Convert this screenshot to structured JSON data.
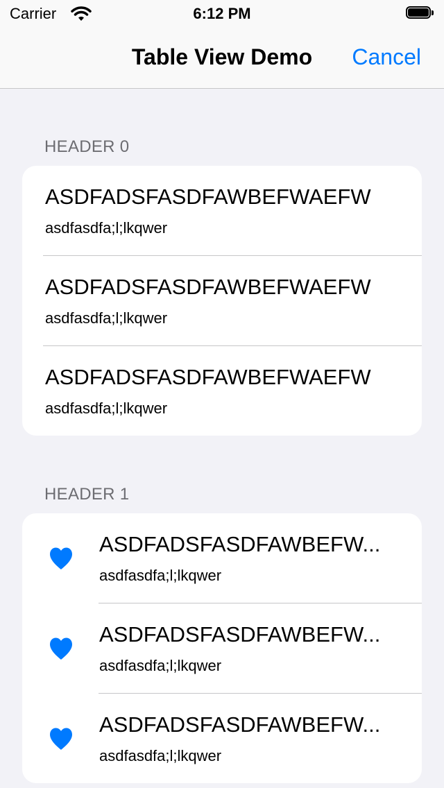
{
  "status_bar": {
    "carrier": "Carrier",
    "time": "6:12 PM",
    "icons": [
      "wifi-icon",
      "battery-icon"
    ]
  },
  "nav_bar": {
    "title": "Table View Demo",
    "cancel_label": "Cancel",
    "accent_color": "#007aff"
  },
  "sections": [
    {
      "header": "HEADER 0",
      "rows": [
        {
          "title": "ASDFADSFASDFAWBEFWAEFW",
          "subtitle": "asdfasdfa;l;lkqwer"
        },
        {
          "title": "ASDFADSFASDFAWBEFWAEFW",
          "subtitle": "asdfasdfa;l;lkqwer"
        },
        {
          "title": "ASDFADSFASDFAWBEFWAEFW",
          "subtitle": "asdfasdfa;l;lkqwer"
        }
      ]
    },
    {
      "header": "HEADER 1",
      "rows": [
        {
          "icon": "heart-icon",
          "title": "ASDFADSFASDFAWBEFW...",
          "subtitle": "asdfasdfa;l;lkqwer"
        },
        {
          "icon": "heart-icon",
          "title": "ASDFADSFASDFAWBEFW...",
          "subtitle": "asdfasdfa;l;lkqwer"
        },
        {
          "icon": "heart-icon",
          "title": "ASDFADSFASDFAWBEFW...",
          "subtitle": "asdfasdfa;l;lkqwer"
        }
      ]
    }
  ]
}
